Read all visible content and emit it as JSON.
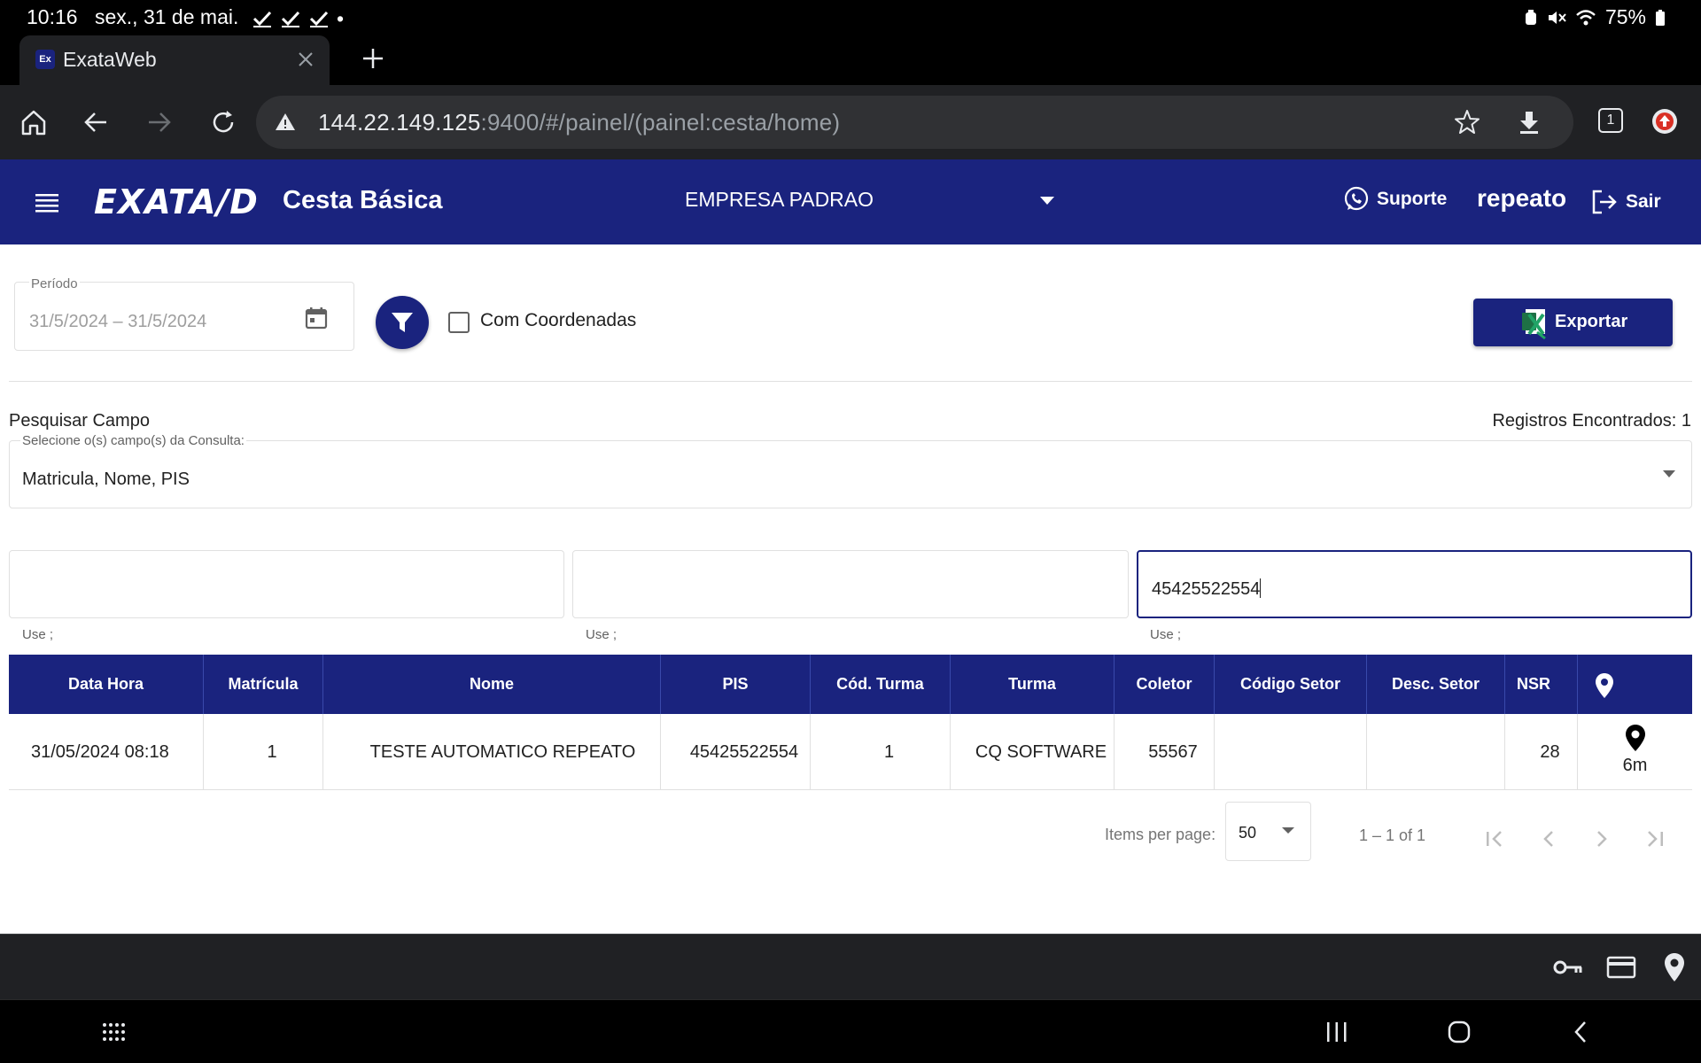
{
  "status_bar": {
    "time": "10:16",
    "date": "sex., 31 de mai.",
    "dot": "•",
    "battery": "75%"
  },
  "browser": {
    "tab_title": "ExataWeb",
    "favicon_text": "Ex",
    "url_host": "144.22.149.125",
    "url_rest": ":9400/#/painel/(painel:cesta/home)",
    "tab_count": "1"
  },
  "header": {
    "logo": "EXATA/D",
    "module": "Cesta Básica",
    "company": "EMPRESA PADRAO",
    "support_label": "Suporte",
    "user": "repeato",
    "logout_label": "Sair"
  },
  "filters": {
    "period_label": "Período",
    "period_value": "31/5/2024 – 31/5/2024",
    "coords_label": "Com Coordenadas",
    "coords_checked": false,
    "export_label": "Exportar"
  },
  "search": {
    "title": "Pesquisar Campo",
    "records_found": "Registros Encontrados: 1",
    "select_label": "Selecione o(s) campo(s) da Consulta:",
    "select_value": "Matricula, Nome, PIS",
    "inputs": [
      {
        "value": "",
        "hint": "Use ;"
      },
      {
        "value": "",
        "hint": "Use ;"
      },
      {
        "value": "45425522554",
        "hint": "Use ;"
      }
    ]
  },
  "table": {
    "columns": [
      "Data Hora",
      "Matrícula",
      "Nome",
      "PIS",
      "Cód. Turma",
      "Turma",
      "Coletor",
      "Código Setor",
      "Desc. Setor",
      "NSR"
    ],
    "location_column_icon": "map-pin-icon",
    "rows": [
      {
        "cells": [
          "31/05/2024 08:18",
          "1",
          "TESTE AUTOMATICO REPEATO",
          "45425522554",
          "1",
          "CQ SOFTWARE",
          "55567",
          "",
          "",
          "28"
        ],
        "location_distance": "6m"
      }
    ]
  },
  "paginator": {
    "items_per_page_label": "Items per page:",
    "page_size": "50",
    "range": "1 – 1 of 1"
  },
  "colors": {
    "primary": "#1a237e",
    "browser_bg": "#202124",
    "omnibox_bg": "#303134"
  }
}
